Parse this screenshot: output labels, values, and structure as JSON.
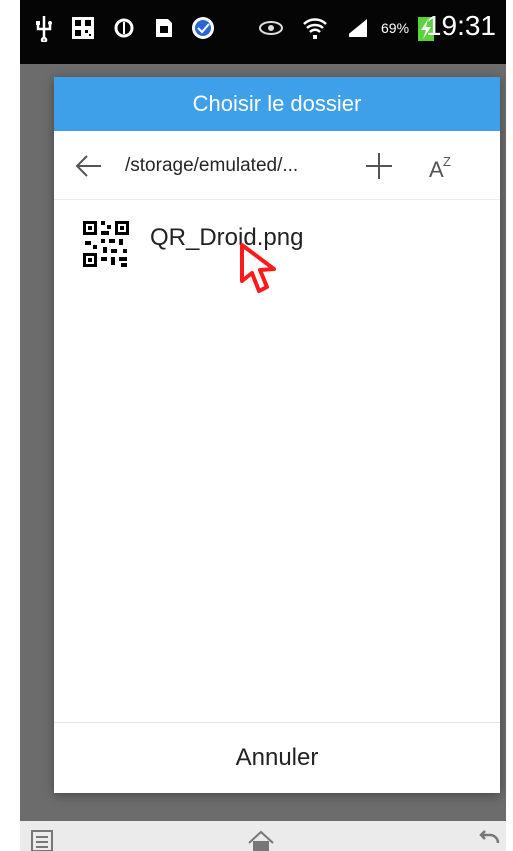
{
  "status_bar": {
    "battery_percent": "69%",
    "time": "19:31",
    "icons": [
      "usb-icon",
      "qr-code-notification-icon",
      "sync-icon",
      "sd-card-icon",
      "blue-app-icon",
      "eye-icon",
      "wifi-icon",
      "signal-icon",
      "battery-charging-icon"
    ]
  },
  "dialog": {
    "title": "Choisir le dossier",
    "path": "/storage/emulated/...",
    "toolbar": {
      "back_icon": "back-arrow-icon",
      "add_icon": "plus-icon",
      "sort_icon": "az-sort-icon"
    },
    "files": [
      {
        "name": "QR_Droid.png",
        "icon": "qr-code-thumbnail-icon"
      }
    ],
    "cancel_label": "Annuler"
  },
  "nav_bar": {
    "icons": [
      "menu-icon",
      "home-icon",
      "back-icon"
    ]
  },
  "colors": {
    "title_bar": "#3fa0ea",
    "overlay": "#6c6c6c",
    "status_bar": "#050505",
    "cursor": "#ff1a1a"
  }
}
